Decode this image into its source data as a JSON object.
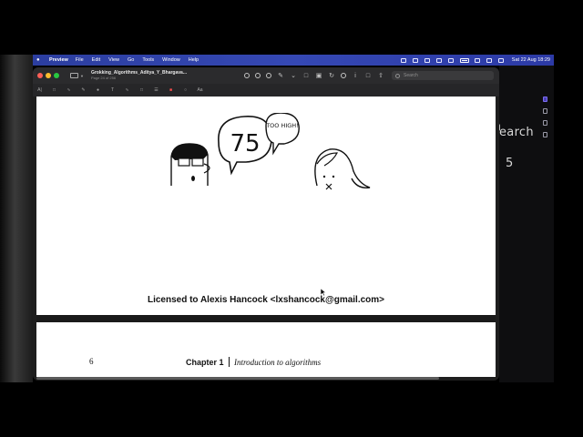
{
  "menubar": {
    "app_name": "Preview",
    "items": [
      "File",
      "Edit",
      "View",
      "Go",
      "Tools",
      "Window",
      "Help"
    ],
    "clock": "Sat 22 Aug  18:29"
  },
  "window": {
    "title": "Grokking_Algorithms_Aditya_Y_Bhargava...",
    "subtitle": "Page 24 of 256",
    "search_placeholder": "Search"
  },
  "document": {
    "bubble_number": "75",
    "bubble_text": "TOO HIGH!",
    "license": "Licensed to Alexis Hancock <lxshancock@gmail.com>",
    "page_number": "6",
    "chapter": "Chapter 1",
    "chapter_title": "Introduction to algorithms"
  },
  "background_app": {
    "peek_text": "earch",
    "peek_number": "5"
  }
}
